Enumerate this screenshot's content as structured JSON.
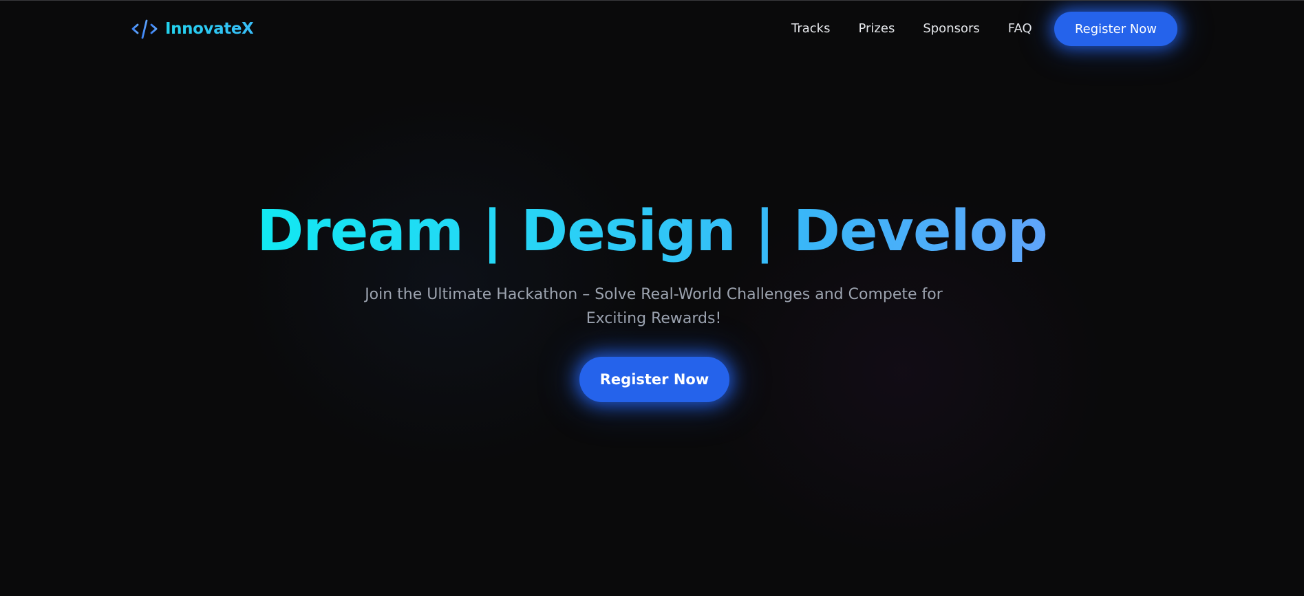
{
  "brand": {
    "name": "InnovateX",
    "icon": "code-brackets-icon"
  },
  "nav": {
    "links": [
      {
        "label": "Tracks"
      },
      {
        "label": "Prizes"
      },
      {
        "label": "Sponsors"
      },
      {
        "label": "FAQ"
      }
    ],
    "cta_label": "Register Now"
  },
  "hero": {
    "title": "Dream | Design | Develop",
    "subtitle": "Join the Ultimate Hackathon – Solve Real-World Challenges and Compete for Exciting Rewards!",
    "cta_label": "Register Now"
  },
  "colors": {
    "background": "#0a0a0b",
    "accent": "#2563eb",
    "gradient_start": "#12e8f2",
    "gradient_end": "#60a5fa",
    "text": "#e5e7eb",
    "muted_text": "#9ca3af"
  }
}
